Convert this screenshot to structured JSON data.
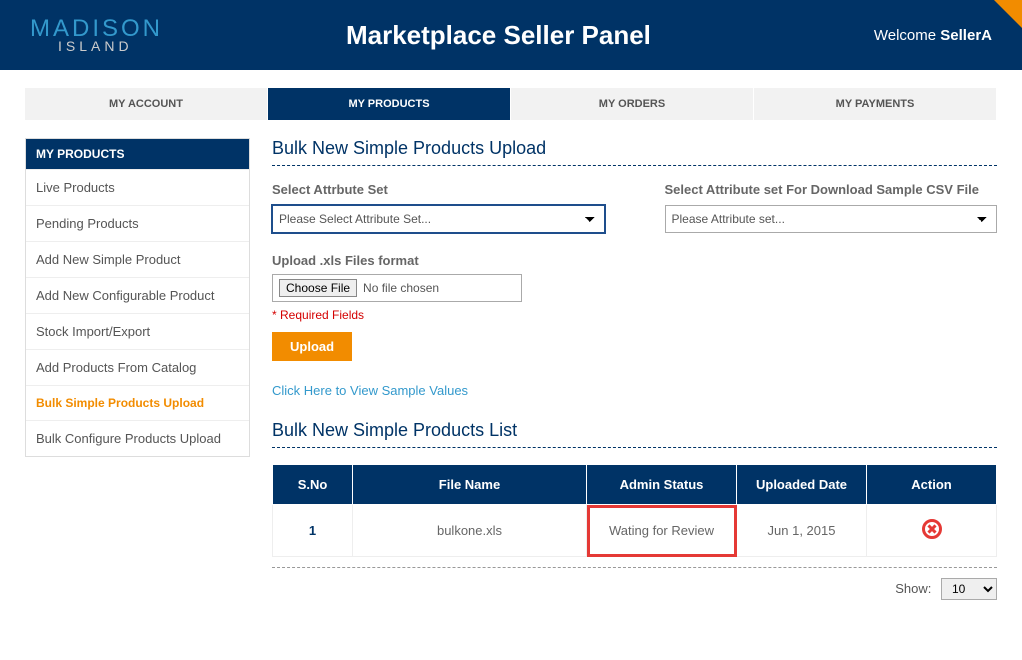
{
  "header": {
    "logo_top": "MADISON",
    "logo_bottom": "ISLAND",
    "title": "Marketplace Seller Panel",
    "welcome_prefix": "Welcome ",
    "welcome_user": "SellerA"
  },
  "tabs": [
    {
      "label": "MY ACCOUNT",
      "active": false
    },
    {
      "label": "MY PRODUCTS",
      "active": true
    },
    {
      "label": "MY ORDERS",
      "active": false
    },
    {
      "label": "MY PAYMENTS",
      "active": false
    }
  ],
  "sidebar": {
    "title": "MY PRODUCTS",
    "items": [
      {
        "label": "Live Products",
        "active": false
      },
      {
        "label": "Pending Products",
        "active": false
      },
      {
        "label": "Add New Simple Product",
        "active": false
      },
      {
        "label": "Add New Configurable Product",
        "active": false
      },
      {
        "label": "Stock Import/Export",
        "active": false
      },
      {
        "label": "Add Products From Catalog",
        "active": false
      },
      {
        "label": "Bulk Simple Products Upload",
        "active": true
      },
      {
        "label": "Bulk Configure Products Upload",
        "active": false
      }
    ]
  },
  "main": {
    "upload_section_title": "Bulk New Simple Products Upload",
    "attr_set_label": "Select Attrbute Set",
    "attr_set_placeholder": "Please Select Attribute Set...",
    "download_label": "Select Attribute set For Download Sample CSV File",
    "download_placeholder": "Please Attribute set...",
    "upload_label": "Upload .xls Files format",
    "choose_file_label": "Choose File",
    "no_file_text": "No file chosen",
    "required_text": "* Required Fields",
    "upload_button": "Upload",
    "sample_link": "Click Here to View Sample Values",
    "list_section_title": "Bulk New Simple Products List",
    "table_headers": [
      "S.No",
      "File Name",
      "Admin Status",
      "Uploaded Date",
      "Action"
    ],
    "table_rows": [
      {
        "sno": "1",
        "filename": "bulkone.xls",
        "status": "Wating for Review",
        "date": "Jun 1, 2015"
      }
    ],
    "show_label": "Show:",
    "show_value": "10"
  }
}
